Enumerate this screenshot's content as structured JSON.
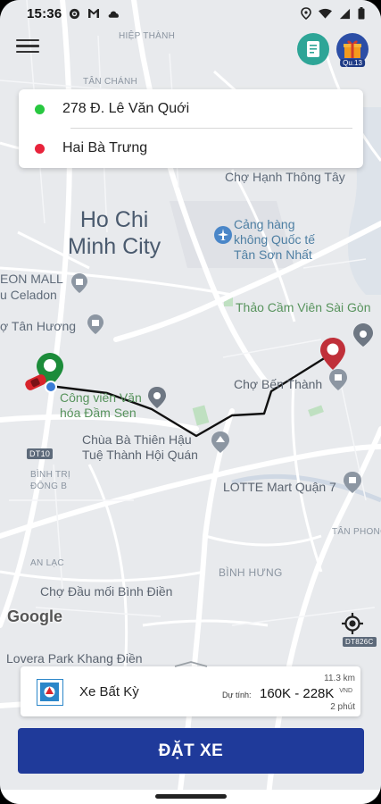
{
  "status_bar": {
    "time": "15:36",
    "left_icons": [
      "gear-icon",
      "gmail-icon",
      "cloud-icon"
    ],
    "right_icons": [
      "location-icon",
      "wifi-icon",
      "signal-icon",
      "battery-icon"
    ]
  },
  "header": {
    "menu_icon": "hamburger-icon",
    "note_icon": "note-icon",
    "gift_icon": "gift-icon",
    "gift_badge": "Qu.13"
  },
  "route": {
    "pickup": "278 Đ. Lê Văn Quới",
    "destination": "Hai Bà Trưng",
    "pickup_color": "#28c840",
    "destination_color": "#e8233b"
  },
  "map": {
    "labels": {
      "hiep_thanh": "HIỆP THÀNH",
      "tan_chanh": "TÂN CHÁNH",
      "cho_hanh_thong_tay": "Chợ Hạnh Thông Tây",
      "city_line1": "Ho Chi",
      "city_line2": "Minh City",
      "airport_line1": "Cảng hàng",
      "airport_line2": "không Quốc tế",
      "airport_line3": "Tân Sơn Nhất",
      "aeon_line1": "EON MALL",
      "aeon_line2": "u Celadon",
      "tan_huong": "ợ Tân Hương",
      "zoo": "Thảo Cầm Viên Sài Gòn",
      "park_line1": "Công viên Văn",
      "park_line2": "hóa Đầm Sen",
      "ben_thanh": "Chợ Bến Thành",
      "pagoda_line1": "Chùa Bà Thiên Hậu",
      "pagoda_line2": "Tuệ Thành Hội Quán",
      "dt10": "DT10",
      "binh_tri_dong": "BÌNH TRỊ\nĐÔNG B",
      "lotte": "LOTTE Mart Quận 7",
      "an_lac": "AN LẠC",
      "tan_phong": "TÂN PHONG",
      "binh_hung": "BÌNH HƯNG",
      "dt826c": "DT826C",
      "cho_dau_moi": "Chợ Đầu mối Bình Điền",
      "lovera": "Lovera Park Khang Điền",
      "google": "Google"
    }
  },
  "vehicle": {
    "name": "Xe Bất Kỳ",
    "distance": "11.3 km",
    "currency": "VND",
    "estimate_label": "Dự tính:",
    "price": "160K - 228K",
    "eta": "2 phút"
  },
  "book_button": "ĐẶT XE"
}
